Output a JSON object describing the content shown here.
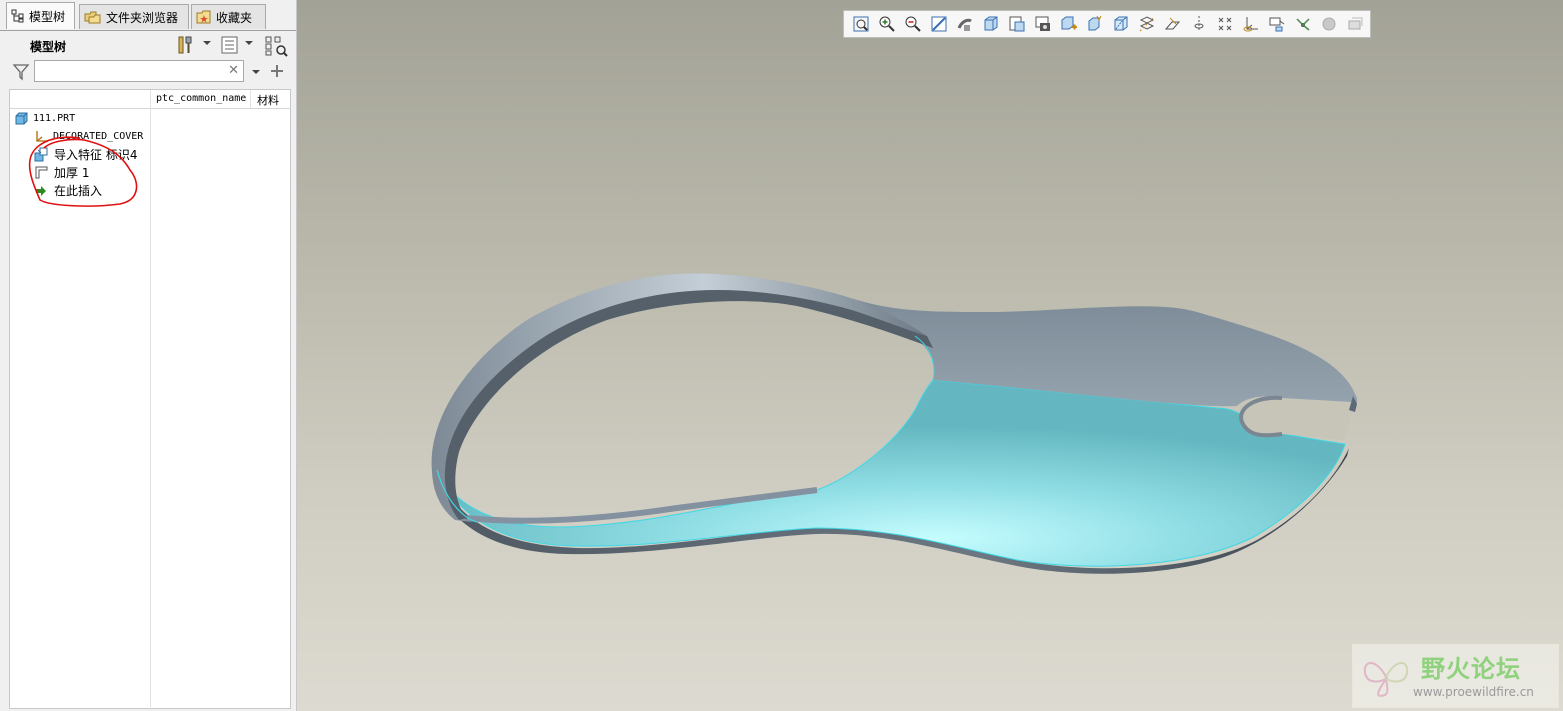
{
  "tabs": [
    {
      "label": "模型树"
    },
    {
      "label": "文件夹浏览器"
    },
    {
      "label": "收藏夹"
    }
  ],
  "tree_panel": {
    "title": "模型树",
    "search_placeholder": "",
    "search_value": "",
    "columns": [
      "ptc_common_name",
      "材料"
    ]
  },
  "tree_items": [
    {
      "label": "111.PRT",
      "icon": "part-icon"
    },
    {
      "label": "DECORATED_COVER",
      "icon": "csys-icon"
    },
    {
      "label": "导入特征 标识4",
      "icon": "import-feature-icon"
    },
    {
      "label": "加厚 1",
      "icon": "thicken-icon"
    },
    {
      "label": "在此插入",
      "icon": "insert-here-arrow-icon"
    }
  ],
  "view_toolbar": [
    "refit-icon",
    "zoom-in-icon",
    "zoom-out-icon",
    "repaint-icon",
    "spin-center-icon",
    "shading-icon",
    "named-views-icon",
    "saved-orientations-icon",
    "view-manager-icon",
    "perspective-icon",
    "display-style-icon",
    "datum-planes-icon",
    "datum-axes-icon",
    "point-display-icon",
    "point-tags-icon",
    "csys-display-icon",
    "annotations-icon",
    "spin-center-toggle-icon",
    "appearance-icon",
    "section-icon"
  ],
  "watermark": {
    "title": "野火论坛",
    "url": "www.proewildfire.cn"
  },
  "colors": {
    "model_body": "#8d9aa6",
    "model_selected": "#6fd0d8",
    "annotation_circle": "#e01010"
  }
}
